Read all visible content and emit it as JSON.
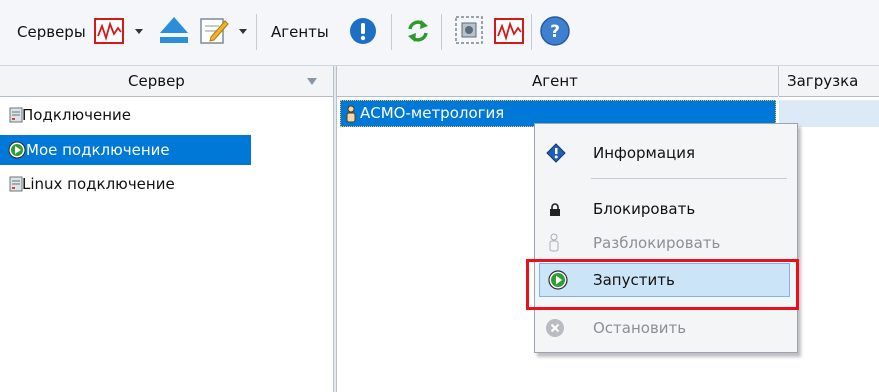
{
  "toolbar": {
    "servers_label": "Серверы",
    "agents_label": "Агенты"
  },
  "columns": {
    "server": "Сервер",
    "agent": "Агент",
    "load": "Загрузка"
  },
  "servers": [
    {
      "label": "Подключение",
      "icon": "server-icon",
      "selected": false
    },
    {
      "label": "Мое подключение",
      "icon": "play-icon",
      "selected": true
    },
    {
      "label": "Linux подключение",
      "icon": "server-icon",
      "selected": false
    }
  ],
  "agent_row": {
    "label": "АСМО-метрология"
  },
  "context_menu": {
    "info": "Информация",
    "block": "Блокировать",
    "unblock": "Разблокировать",
    "start": "Запустить",
    "stop": "Остановить"
  },
  "colors": {
    "selection": "#0078d7",
    "highlight_border": "#e8101a",
    "menu_hover": "#cce4f7"
  }
}
